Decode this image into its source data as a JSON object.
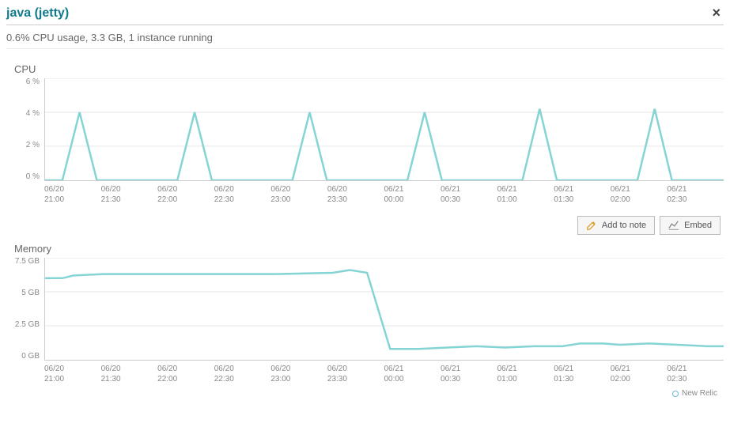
{
  "header": {
    "title": "java (jetty)",
    "close_label": "×"
  },
  "subheader": {
    "text": "0.6% CPU usage, 3.3 GB, 1 instance running"
  },
  "toolbar": {
    "add_to_note": "Add to note",
    "embed": "Embed"
  },
  "brand": {
    "label": "New Relic"
  },
  "chart_data": [
    {
      "type": "line",
      "title": "CPU",
      "xlabel": "",
      "ylabel": "",
      "categories": [
        "06/20 21:00",
        "06/20 21:30",
        "06/20 22:00",
        "06/20 22:30",
        "06/20 23:00",
        "06/20 23:30",
        "06/21 00:00",
        "06/21 00:30",
        "06/21 01:00",
        "06/21 01:30",
        "06/21 02:00",
        "06/21 02:30"
      ],
      "y_ticks": [
        "6 %",
        "4 %",
        "2 %",
        "0 %"
      ],
      "ylim": [
        0,
        6
      ],
      "series": [
        {
          "name": "cpu",
          "x_index": [
            0,
            0.3,
            0.6,
            0.9,
            1.2,
            2.3,
            2.6,
            2.9,
            3.2,
            4.3,
            4.6,
            4.9,
            5.2,
            6.3,
            6.6,
            6.9,
            7.2,
            8.3,
            8.6,
            8.9,
            9.2,
            10.3,
            10.6,
            10.9,
            11.2,
            11.8
          ],
          "values": [
            0,
            0,
            4.0,
            0,
            0,
            0,
            4.0,
            0,
            0,
            0,
            4.0,
            0,
            0,
            0,
            4.0,
            0,
            0,
            0,
            4.2,
            0,
            0,
            0,
            4.2,
            0,
            0,
            0
          ]
        }
      ]
    },
    {
      "type": "line",
      "title": "Memory",
      "xlabel": "",
      "ylabel": "",
      "categories": [
        "06/20 21:00",
        "06/20 21:30",
        "06/20 22:00",
        "06/20 22:30",
        "06/20 23:00",
        "06/20 23:30",
        "06/21 00:00",
        "06/21 00:30",
        "06/21 01:00",
        "06/21 01:30",
        "06/21 02:00",
        "06/21 02:30"
      ],
      "y_ticks": [
        "7.5 GB",
        "5 GB",
        "2.5 GB",
        "0 GB"
      ],
      "ylim": [
        0,
        7.5
      ],
      "series": [
        {
          "name": "memory",
          "x_index": [
            0,
            0.3,
            0.5,
            1,
            2,
            3,
            4,
            5,
            5.3,
            5.6,
            6,
            6.5,
            7,
            7.5,
            8,
            8.5,
            9,
            9.3,
            9.7,
            10,
            10.5,
            11,
            11.5,
            11.8
          ],
          "values": [
            6.0,
            6.0,
            6.2,
            6.3,
            6.3,
            6.3,
            6.3,
            6.4,
            6.6,
            6.4,
            0.8,
            0.8,
            0.9,
            1.0,
            0.9,
            1.0,
            1.0,
            1.2,
            1.2,
            1.1,
            1.2,
            1.1,
            1.0,
            1.0
          ]
        }
      ]
    }
  ]
}
